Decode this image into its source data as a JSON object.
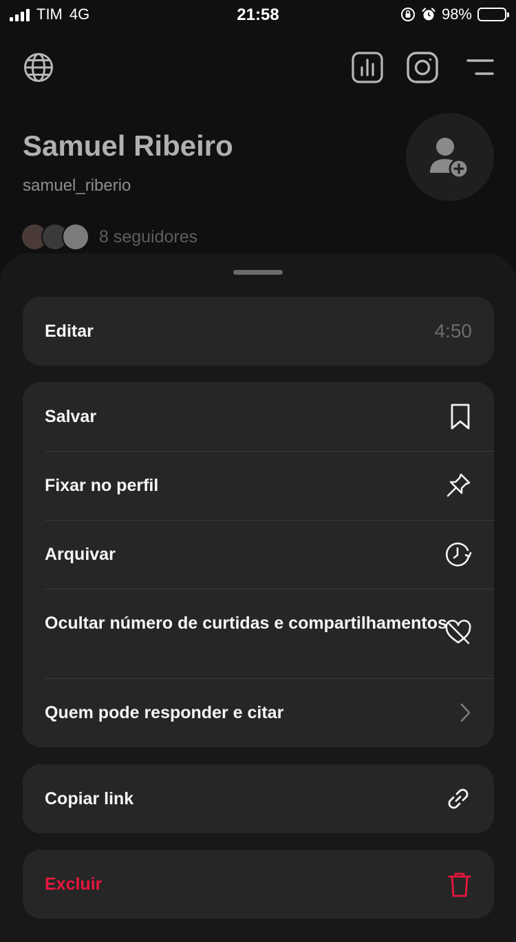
{
  "status_bar": {
    "carrier": "TIM",
    "network": "4G",
    "time": "21:58",
    "battery": "98%",
    "battery_level": 0.98
  },
  "profile": {
    "name": "Samuel Ribeiro",
    "handle": "samuel_riberio",
    "followers": "8 seguidores"
  },
  "menu": {
    "edit": {
      "label": "Editar",
      "time": "4:50"
    },
    "group2": [
      {
        "label": "Salvar",
        "icon": "bookmark-icon"
      },
      {
        "label": "Fixar no perfil",
        "icon": "pin-icon"
      },
      {
        "label": "Arquivar",
        "icon": "archive-clock-icon"
      },
      {
        "label": "Ocultar número de curtidas e compartilhamentos",
        "icon": "heart-off-icon"
      },
      {
        "label": "Quem pode responder e citar",
        "icon": "chevron-right-icon"
      }
    ],
    "copy_link": {
      "label": "Copiar link",
      "icon": "link-icon"
    },
    "delete": {
      "label": "Excluir",
      "icon": "trash-icon"
    }
  },
  "colors": {
    "background": "#101010",
    "sheet": "#181818",
    "card": "#262626",
    "danger": "#e8163e"
  }
}
